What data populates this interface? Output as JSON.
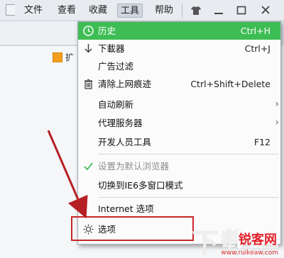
{
  "menubar": {
    "items": [
      "文件",
      "查看",
      "收藏",
      "工具",
      "帮助"
    ],
    "controls": [
      "shirt-icon",
      "minimize-icon",
      "maximize-icon",
      "close-icon"
    ]
  },
  "bookmark": {
    "label": "扩"
  },
  "tools_menu": {
    "items": [
      {
        "label": "历史",
        "shortcut": "Ctrl+H",
        "icon": "history-icon",
        "highlighted": true
      },
      {
        "label": "下載器",
        "shortcut": "Ctrl+J",
        "icon": "download-icon"
      },
      {
        "label": "广告过滤",
        "shortcut": ""
      },
      {
        "label": "清除上网痕迹",
        "shortcut": "Ctrl+Shift+Delete",
        "icon": "trash-icon"
      },
      {
        "label": "自动刷新",
        "shortcut": "",
        "submenu": true
      },
      {
        "label": "代理服务器",
        "shortcut": "",
        "submenu": true
      },
      {
        "label": "开发人员工具",
        "shortcut": "F12"
      },
      {
        "label": "设置为默认浏览器",
        "shortcut": "",
        "disabled": true,
        "icon": "check-icon"
      },
      {
        "label": "切换到IE6多窗口模式",
        "shortcut": ""
      },
      {
        "label": "Internet 选项",
        "shortcut": ""
      },
      {
        "label": "选项",
        "shortcut": "",
        "icon": "gear-icon"
      }
    ]
  },
  "watermark": {
    "logo": "锐客网",
    "url": "www.ruikeaw.com"
  },
  "colors": {
    "highlight": "#3fbd55",
    "annotation": "#c8272c"
  }
}
